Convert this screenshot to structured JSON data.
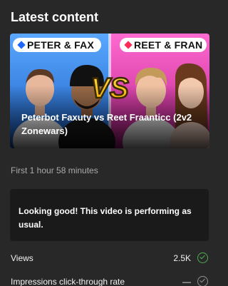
{
  "section": {
    "title": "Latest content"
  },
  "video": {
    "title": "Peterbot Faxuty vs Reet Fraanticc (2v2 Zonewars)",
    "thumbnail": {
      "left_tag": "PETER & FAX",
      "right_tag": "REET & FRAN",
      "versus": "VS",
      "left_tag_icon_color": "#1e66ff",
      "right_tag_icon_color": "#ff2a55"
    },
    "published": "First 1 hour 58 minutes"
  },
  "performance": {
    "message": "Looking good! This video is performing as usual."
  },
  "metrics": [
    {
      "name": "Views",
      "value": "2.5K",
      "status": "good",
      "status_icon": "check-circle-icon"
    },
    {
      "name": "Impressions click-through rate",
      "value": "—",
      "status": "neutral",
      "status_icon": "check-circle-icon"
    }
  ],
  "colors": {
    "background": "#282828",
    "card": "#1a1a1a",
    "good": "#4caf50",
    "neutral": "#909090",
    "thumb_left_bg": "#3b8ee8",
    "thumb_right_bg": "#e83ba9"
  }
}
